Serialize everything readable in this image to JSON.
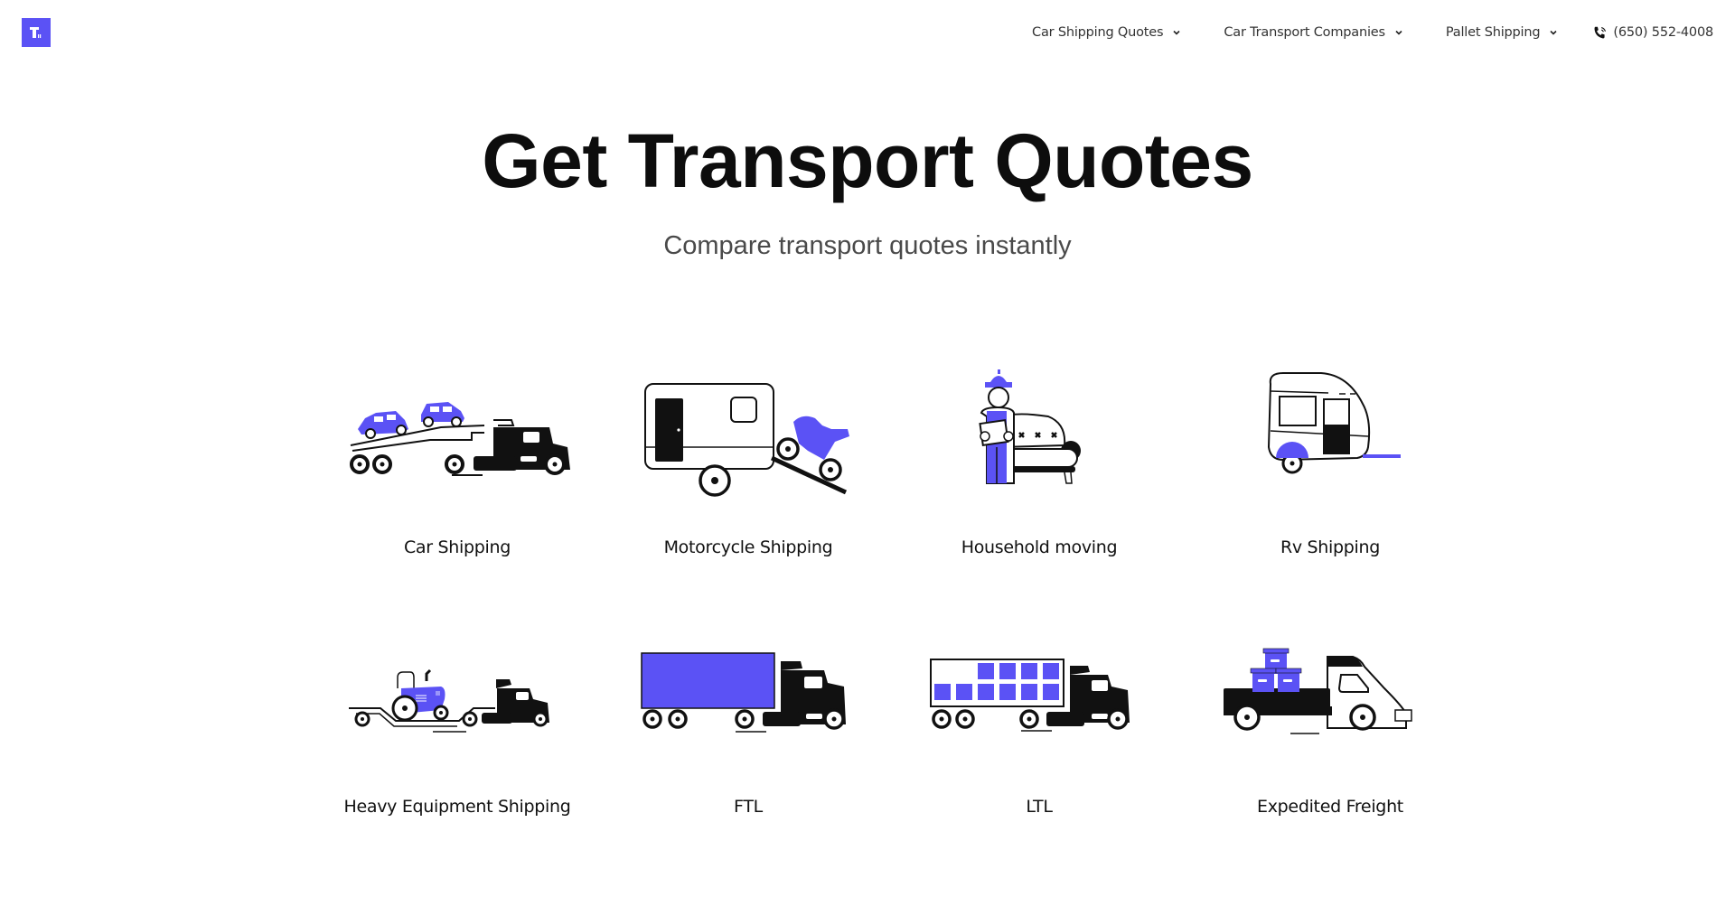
{
  "brand": {
    "logo_icon": "logo-mark-icon",
    "accent_color": "#5b52f5"
  },
  "nav": {
    "items": [
      {
        "label": "Car Shipping Quotes",
        "icon": "chevron-down-icon"
      },
      {
        "label": "Car Transport Companies",
        "icon": "chevron-down-icon"
      },
      {
        "label": "Pallet Shipping",
        "icon": "chevron-down-icon"
      }
    ],
    "phone": {
      "label": "(650) 552-4008",
      "icon": "phone-icon"
    }
  },
  "hero": {
    "title": "Get Transport Quotes",
    "subtitle": "Compare transport quotes instantly"
  },
  "services": [
    {
      "label": "Car Shipping",
      "icon": "car-carrier-truck-icon"
    },
    {
      "label": "Motorcycle Shipping",
      "icon": "motorcycle-trailer-icon"
    },
    {
      "label": "Household moving",
      "icon": "mover-with-sofa-icon"
    },
    {
      "label": "Rv Shipping",
      "icon": "rv-camper-icon"
    },
    {
      "label": "Heavy Equipment Shipping",
      "icon": "tractor-lowboy-truck-icon"
    },
    {
      "label": "FTL",
      "icon": "full-truckload-icon"
    },
    {
      "label": "LTL",
      "icon": "less-than-truckload-icon"
    },
    {
      "label": "Expedited Freight",
      "icon": "delivery-van-boxes-icon"
    }
  ]
}
